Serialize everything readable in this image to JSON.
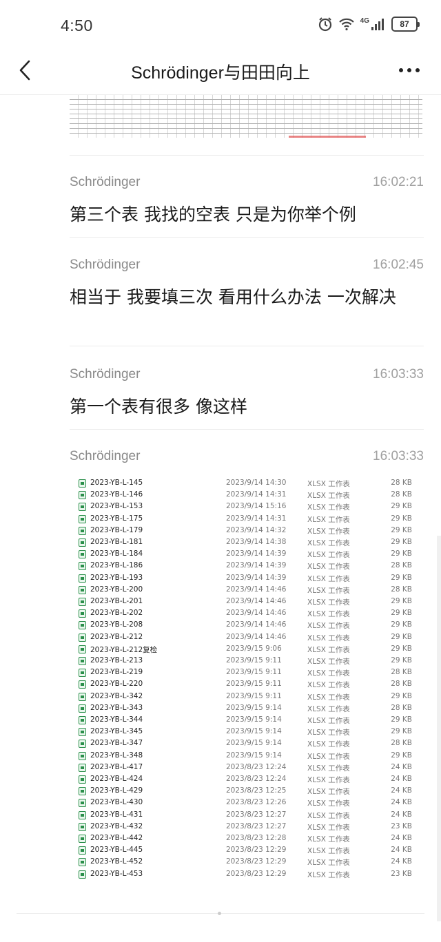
{
  "status_bar": {
    "time": "4:50",
    "network": "4G",
    "battery": "87"
  },
  "header": {
    "title": "Schrödinger与田田向上",
    "icons": [
      "back-arrow-icon",
      "more-icon"
    ]
  },
  "messages": [
    {
      "sender": "Schrödinger",
      "time": "16:02:21",
      "text": "第三个表 我找的空表 只是为你举个例"
    },
    {
      "sender": "Schrödinger",
      "time": "16:02:45",
      "text": "相当于  我要填三次 看用什么办法 一次解决"
    },
    {
      "sender": "Schrödinger",
      "time": "16:03:33",
      "text": "第一个表有很多 像这样"
    },
    {
      "sender": "Schrödinger",
      "time": "16:03:33",
      "text": ""
    }
  ],
  "file_list": [
    {
      "name": "2023-YB-L-145",
      "date": "2023/9/14 14:30",
      "type": "XLSX 工作表",
      "size": "28 KB"
    },
    {
      "name": "2023-YB-L-146",
      "date": "2023/9/14 14:31",
      "type": "XLSX 工作表",
      "size": "28 KB"
    },
    {
      "name": "2023-YB-L-153",
      "date": "2023/9/14 15:16",
      "type": "XLSX 工作表",
      "size": "29 KB"
    },
    {
      "name": "2023-YB-L-175",
      "date": "2023/9/14 14:31",
      "type": "XLSX 工作表",
      "size": "29 KB"
    },
    {
      "name": "2023-YB-L-179",
      "date": "2023/9/14 14:32",
      "type": "XLSX 工作表",
      "size": "29 KB"
    },
    {
      "name": "2023-YB-L-181",
      "date": "2023/9/14 14:38",
      "type": "XLSX 工作表",
      "size": "29 KB"
    },
    {
      "name": "2023-YB-L-184",
      "date": "2023/9/14 14:39",
      "type": "XLSX 工作表",
      "size": "29 KB"
    },
    {
      "name": "2023-YB-L-186",
      "date": "2023/9/14 14:39",
      "type": "XLSX 工作表",
      "size": "28 KB"
    },
    {
      "name": "2023-YB-L-193",
      "date": "2023/9/14 14:39",
      "type": "XLSX 工作表",
      "size": "29 KB"
    },
    {
      "name": "2023-YB-L-200",
      "date": "2023/9/14 14:46",
      "type": "XLSX 工作表",
      "size": "28 KB"
    },
    {
      "name": "2023-YB-L-201",
      "date": "2023/9/14 14:46",
      "type": "XLSX 工作表",
      "size": "29 KB"
    },
    {
      "name": "2023-YB-L-202",
      "date": "2023/9/14 14:46",
      "type": "XLSX 工作表",
      "size": "29 KB"
    },
    {
      "name": "2023-YB-L-208",
      "date": "2023/9/14 14:46",
      "type": "XLSX 工作表",
      "size": "29 KB"
    },
    {
      "name": "2023-YB-L-212",
      "date": "2023/9/14 14:46",
      "type": "XLSX 工作表",
      "size": "29 KB"
    },
    {
      "name": "2023-YB-L-212复检",
      "date": "2023/9/15 9:06",
      "type": "XLSX 工作表",
      "size": "29 KB"
    },
    {
      "name": "2023-YB-L-213",
      "date": "2023/9/15 9:11",
      "type": "XLSX 工作表",
      "size": "29 KB"
    },
    {
      "name": "2023-YB-L-219",
      "date": "2023/9/15 9:11",
      "type": "XLSX 工作表",
      "size": "28 KB"
    },
    {
      "name": "2023-YB-L-220",
      "date": "2023/9/15 9:11",
      "type": "XLSX 工作表",
      "size": "28 KB"
    },
    {
      "name": "2023-YB-L-342",
      "date": "2023/9/15 9:11",
      "type": "XLSX 工作表",
      "size": "29 KB"
    },
    {
      "name": "2023-YB-L-343",
      "date": "2023/9/15 9:14",
      "type": "XLSX 工作表",
      "size": "28 KB"
    },
    {
      "name": "2023-YB-L-344",
      "date": "2023/9/15 9:14",
      "type": "XLSX 工作表",
      "size": "29 KB"
    },
    {
      "name": "2023-YB-L-345",
      "date": "2023/9/15 9:14",
      "type": "XLSX 工作表",
      "size": "29 KB"
    },
    {
      "name": "2023-YB-L-347",
      "date": "2023/9/15 9:14",
      "type": "XLSX 工作表",
      "size": "28 KB"
    },
    {
      "name": "2023-YB-L-348",
      "date": "2023/9/15 9:14",
      "type": "XLSX 工作表",
      "size": "29 KB"
    },
    {
      "name": "2023-YB-L-417",
      "date": "2023/8/23 12:24",
      "type": "XLSX 工作表",
      "size": "24 KB"
    },
    {
      "name": "2023-YB-L-424",
      "date": "2023/8/23 12:24",
      "type": "XLSX 工作表",
      "size": "24 KB"
    },
    {
      "name": "2023-YB-L-429",
      "date": "2023/8/23 12:25",
      "type": "XLSX 工作表",
      "size": "24 KB"
    },
    {
      "name": "2023-YB-L-430",
      "date": "2023/8/23 12:26",
      "type": "XLSX 工作表",
      "size": "24 KB"
    },
    {
      "name": "2023-YB-L-431",
      "date": "2023/8/23 12:27",
      "type": "XLSX 工作表",
      "size": "24 KB"
    },
    {
      "name": "2023-YB-L-432",
      "date": "2023/8/23 12:27",
      "type": "XLSX 工作表",
      "size": "23 KB"
    },
    {
      "name": "2023-YB-L-442",
      "date": "2023/8/23 12:28",
      "type": "XLSX 工作表",
      "size": "24 KB"
    },
    {
      "name": "2023-YB-L-445",
      "date": "2023/8/23 12:29",
      "type": "XLSX 工作表",
      "size": "24 KB"
    },
    {
      "name": "2023-YB-L-452",
      "date": "2023/8/23 12:29",
      "type": "XLSX 工作表",
      "size": "24 KB"
    },
    {
      "name": "2023-YB-L-453",
      "date": "2023/8/23 12:29",
      "type": "XLSX 工作表",
      "size": "23 KB"
    }
  ]
}
